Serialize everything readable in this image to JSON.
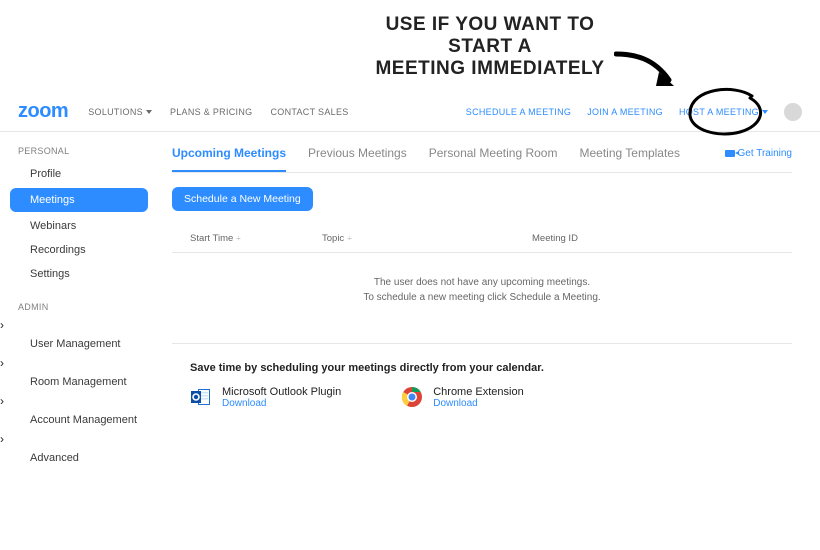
{
  "annotation": {
    "line1": "USE IF YOU WANT TO START A",
    "line2": "MEETING IMMEDIATELY"
  },
  "brand": "zoom",
  "header": {
    "nav": {
      "solutions": "SOLUTIONS",
      "plans": "PLANS & PRICING",
      "contact": "CONTACT SALES"
    },
    "actions": {
      "schedule": "SCHEDULE A MEETING",
      "join": "JOIN A MEETING",
      "host": "HOST A MEETING"
    }
  },
  "sidebar": {
    "personal_title": "PERSONAL",
    "profile": "Profile",
    "meetings": "Meetings",
    "webinars": "Webinars",
    "recordings": "Recordings",
    "settings": "Settings",
    "admin_title": "ADMIN",
    "user_mgmt": "User Management",
    "room_mgmt": "Room Management",
    "acct_mgmt": "Account Management",
    "advanced": "Advanced"
  },
  "tabs": {
    "upcoming": "Upcoming Meetings",
    "previous": "Previous Meetings",
    "personal_room": "Personal Meeting Room",
    "templates": "Meeting Templates",
    "get_training": "Get Training"
  },
  "buttons": {
    "schedule_new": "Schedule a New Meeting"
  },
  "table": {
    "start_time": "Start Time",
    "topic": "Topic",
    "meeting_id": "Meeting ID"
  },
  "empty": {
    "line1": "The user does not have any upcoming meetings.",
    "line2": "To schedule a new meeting click Schedule a Meeting."
  },
  "calendar": {
    "headline": "Save time by scheduling your meetings directly from your calendar.",
    "outlook": {
      "title": "Microsoft Outlook Plugin",
      "download": "Download"
    },
    "chrome": {
      "title": "Chrome Extension",
      "download": "Download"
    }
  },
  "colors": {
    "accent": "#2d8cff"
  }
}
